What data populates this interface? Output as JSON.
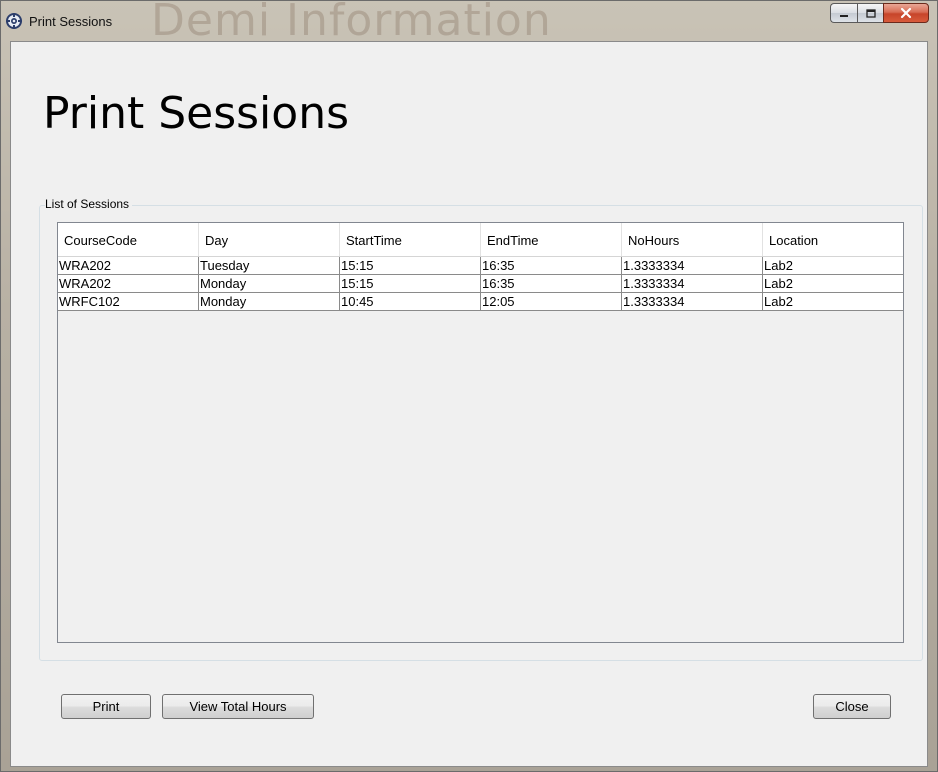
{
  "window": {
    "title": "Print Sessions",
    "watermark": "Demi Information",
    "controls": {
      "minimize_icon": "minimize-icon",
      "maximize_icon": "maximize-icon",
      "close_icon": "close-icon"
    },
    "close_color": "#c7452a"
  },
  "page": {
    "title": "Print Sessions"
  },
  "sessions_group": {
    "label": "List of Sessions",
    "columns": [
      "CourseCode",
      "Day",
      "StartTime",
      "EndTime",
      "NoHours",
      "Location"
    ],
    "rows": [
      [
        "WRA202",
        "Tuesday",
        "15:15",
        "16:35",
        "1.3333334",
        "Lab2"
      ],
      [
        "WRA202",
        "Monday",
        "15:15",
        "16:35",
        "1.3333334",
        "Lab2"
      ],
      [
        "WRFC102",
        "Monday",
        "10:45",
        "12:05",
        "1.3333334",
        "Lab2"
      ]
    ]
  },
  "buttons": {
    "print": "Print",
    "view_total_hours": "View Total Hours",
    "close": "Close"
  }
}
